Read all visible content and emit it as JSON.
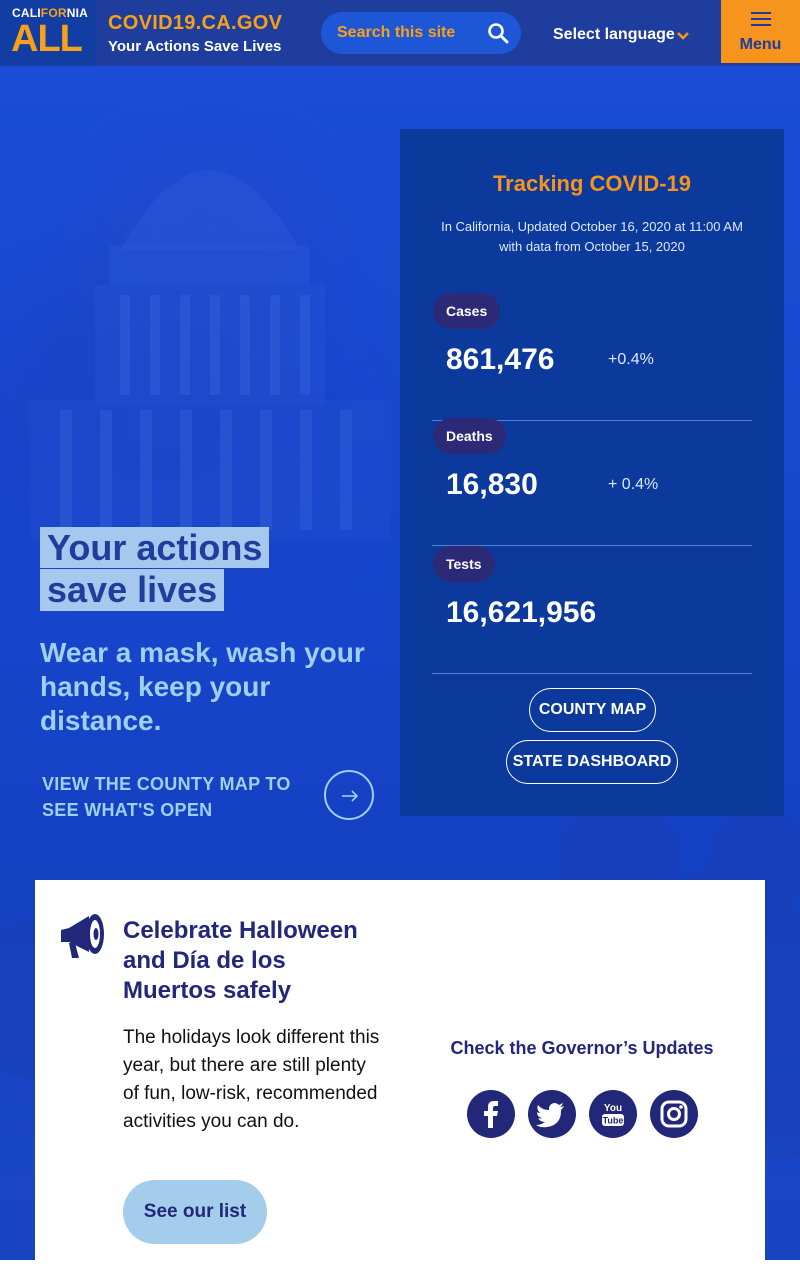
{
  "header": {
    "logo_line1_a": "CALI",
    "logo_line1_b": "FOR",
    "logo_line1_c": "NIA",
    "logo_line2": "ALL",
    "site_title": "COVID19.CA.GOV",
    "site_subtitle": "Your Actions Save Lives",
    "search_placeholder": "Search this site",
    "language_label": "Select language",
    "menu_label": "Menu"
  },
  "hero": {
    "title_line1": "Your actions",
    "title_line2": "save lives",
    "subtitle": "Wear a mask, wash your hands, keep your distance.",
    "link_text": "VIEW THE COUNTY MAP TO SEE WHAT'S OPEN"
  },
  "stats": {
    "title": "Tracking COVID-19",
    "updated": "In California, Updated October 16, 2020 at 11:00 AM with data from October 15, 2020",
    "items": [
      {
        "label": "Cases",
        "value": "861,476",
        "change": "+0.4%"
      },
      {
        "label": "Deaths",
        "value": "16,830",
        "change": "+ 0.4%"
      },
      {
        "label": "Tests",
        "value": "16,621,956",
        "change": ""
      }
    ],
    "county_map_label": "COUNTY MAP",
    "state_dashboard_label": "STATE DASHBOARD"
  },
  "card": {
    "heading": "Celebrate Halloween and Día de los Muertos safely",
    "body": "The holidays look different this year, but there are still plenty of fun, low-risk, recommended activities you can do.",
    "button_label": "See our list",
    "governor_label": "Check the Governor’s Updates",
    "social": [
      "facebook-icon",
      "twitter-icon",
      "youtube-icon",
      "instagram-icon"
    ]
  },
  "colors": {
    "brand_blue": "#1f3d9c",
    "accent_orange": "#f7941d",
    "panel_blue": "#0b3a9c",
    "light_blue": "#9fd0f4",
    "navy": "#22277a"
  }
}
